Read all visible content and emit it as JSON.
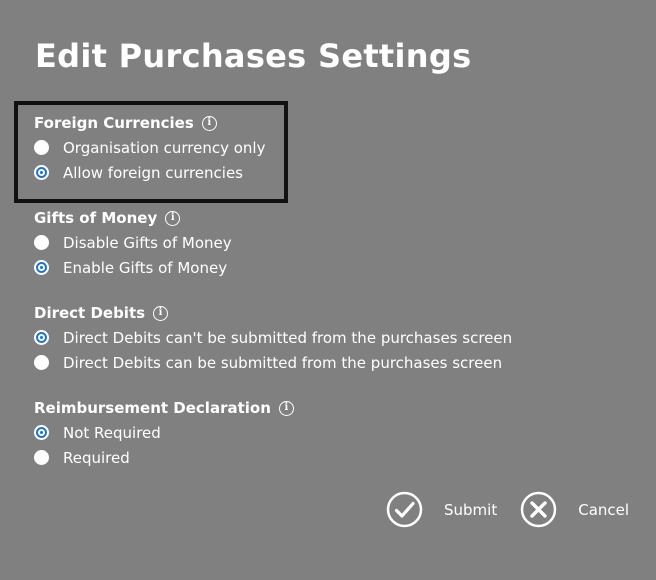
{
  "page": {
    "title": "Edit Purchases Settings"
  },
  "sections": [
    {
      "label": "Foreign Currencies",
      "options": [
        {
          "label": "Organisation currency only",
          "checked": false
        },
        {
          "label": "Allow foreign currencies",
          "checked": true
        }
      ]
    },
    {
      "label": "Gifts of Money",
      "options": [
        {
          "label": "Disable Gifts of Money",
          "checked": false
        },
        {
          "label": "Enable Gifts of Money",
          "checked": true
        }
      ]
    },
    {
      "label": "Direct Debits",
      "options": [
        {
          "label": "Direct Debits can't be submitted from the purchases screen",
          "checked": true
        },
        {
          "label": "Direct Debits can be submitted from the purchases screen",
          "checked": false
        }
      ]
    },
    {
      "label": "Reimbursement Declaration",
      "options": [
        {
          "label": "Not Required",
          "checked": true
        },
        {
          "label": "Required",
          "checked": false
        }
      ]
    }
  ],
  "actions": {
    "submit_label": "Submit",
    "cancel_label": "Cancel"
  },
  "icons": {
    "info": "info-icon",
    "submit": "check-circle-icon",
    "cancel": "x-circle-icon"
  },
  "colors": {
    "background": "#808080",
    "radio_selected": "#1a73c8",
    "highlight_border": "#111111"
  }
}
